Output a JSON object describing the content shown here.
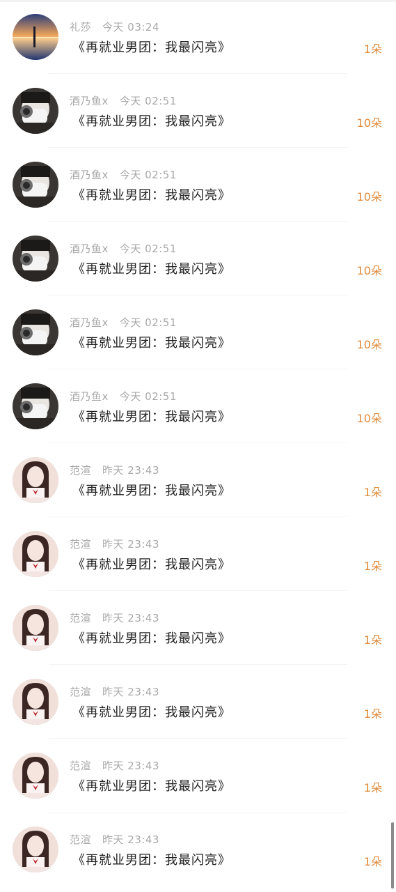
{
  "gifts": [
    {
      "user": "礼莎",
      "time": "今天 03:24",
      "title": "《再就业男团：我最闪亮》",
      "amount": "1朵",
      "avatar": "sunset-lake-avatar"
    },
    {
      "user": "酒乃鱼x",
      "time": "今天 02:51",
      "title": "《再就业男团：我最闪亮》",
      "amount": "10朵",
      "avatar": "masked-person-avatar"
    },
    {
      "user": "酒乃鱼x",
      "time": "今天 02:51",
      "title": "《再就业男团：我最闪亮》",
      "amount": "10朵",
      "avatar": "masked-person-avatar"
    },
    {
      "user": "酒乃鱼x",
      "time": "今天 02:51",
      "title": "《再就业男团：我最闪亮》",
      "amount": "10朵",
      "avatar": "masked-person-avatar"
    },
    {
      "user": "酒乃鱼x",
      "time": "今天 02:51",
      "title": "《再就业男团：我最闪亮》",
      "amount": "10朵",
      "avatar": "masked-person-avatar"
    },
    {
      "user": "酒乃鱼x",
      "time": "今天 02:51",
      "title": "《再就业男团：我最闪亮》",
      "amount": "10朵",
      "avatar": "masked-person-avatar"
    },
    {
      "user": "范渲",
      "time": "昨天 23:43",
      "title": "《再就业男团：我最闪亮》",
      "amount": "1朵",
      "avatar": "anime-girl-avatar"
    },
    {
      "user": "范渲",
      "time": "昨天 23:43",
      "title": "《再就业男团：我最闪亮》",
      "amount": "1朵",
      "avatar": "anime-girl-avatar"
    },
    {
      "user": "范渲",
      "time": "昨天 23:43",
      "title": "《再就业男团：我最闪亮》",
      "amount": "1朵",
      "avatar": "anime-girl-avatar"
    },
    {
      "user": "范渲",
      "time": "昨天 23:43",
      "title": "《再就业男团：我最闪亮》",
      "amount": "1朵",
      "avatar": "anime-girl-avatar"
    },
    {
      "user": "范渲",
      "time": "昨天 23:43",
      "title": "《再就业男团：我最闪亮》",
      "amount": "1朵",
      "avatar": "anime-girl-avatar"
    },
    {
      "user": "范渲",
      "time": "昨天 23:43",
      "title": "《再就业男团：我最闪亮》",
      "amount": "1朵",
      "avatar": "anime-girl-avatar"
    }
  ],
  "colors": {
    "amount": "#e08a3b",
    "meta": "#a8a8a8",
    "title": "#222222"
  }
}
